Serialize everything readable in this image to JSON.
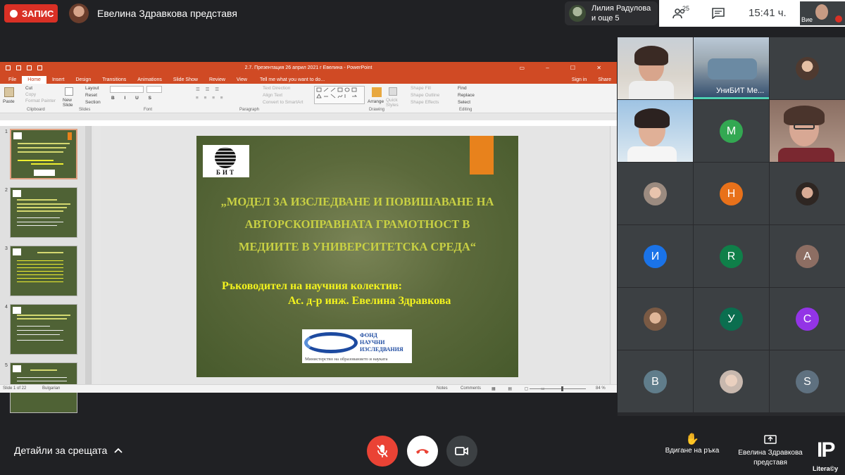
{
  "topbar": {
    "record_label": "ЗАПИС",
    "presenting_text": "Евелина Здравкова представя",
    "chip_line1": "Лилия Радулова",
    "chip_line2": "и още 5",
    "people_count": "25",
    "time": "15:41 ч.",
    "self_label": "Вие"
  },
  "ppt": {
    "window_title": "2.7. Презентация 26 април 2021 г Евелина - PowerPoint",
    "tabs": [
      "File",
      "Home",
      "Insert",
      "Design",
      "Transitions",
      "Animations",
      "Slide Show",
      "Review",
      "View"
    ],
    "tell_me": "Tell me what you want to do...",
    "sign_in": "Sign in",
    "share": "Share",
    "ribbon": {
      "paste": "Paste",
      "cut": "Cut",
      "copy": "Copy",
      "format_painter": "Format Painter",
      "clipboard": "Clipboard",
      "new_slide": "New Slide",
      "layout": "Layout",
      "reset": "Reset",
      "section": "Section",
      "slides": "Slides",
      "font": "Font",
      "paragraph": "Paragraph",
      "text_direction": "Text Direction",
      "align_text": "Align Text",
      "convert_smartart": "Convert to SmartArt",
      "arrange": "Arrange",
      "quick_styles": "Quick Styles",
      "shape_fill": "Shape Fill",
      "shape_outline": "Shape Outline",
      "shape_effects": "Shape Effects",
      "drawing": "Drawing",
      "find": "Find",
      "replace": "Replace",
      "select": "Select",
      "editing": "Editing"
    },
    "slide": {
      "logo_text": "БИТ",
      "title_line1": "„МОДЕЛ ЗА ИЗСЛЕДВАНЕ И ПОВИШАВАНЕ НА",
      "title_line2": "АВТОРСКОПРАВНАТА ГРАМОТНОСТ В",
      "title_line3": "МЕДИИТЕ В УНИВЕРСИТЕТСКА СРЕДА“",
      "leader_label": "Ръководител на научния колектив:",
      "leader_name": "Ас. д-р инж. Евелина Здравкова",
      "fund_line1": "ФОНД",
      "fund_line2": "НАУЧНИ",
      "fund_line3": "ИЗСЛЕДВАНИЯ",
      "ministry": "Министерство на образованието и науката"
    },
    "thumb_numbers": [
      "1",
      "2",
      "3",
      "4",
      "5"
    ],
    "status": {
      "slide_of": "Slide 1 of 22",
      "language": "Bulgarian",
      "notes": "Notes",
      "comments": "Comments",
      "zoom": "84 %"
    }
  },
  "grid": {
    "unibit_label": "УниБИТ Ме...",
    "initials": [
      "M",
      "H",
      "И",
      "R",
      "A",
      "У",
      "C",
      "B",
      "S"
    ],
    "colors": {
      "green": "#33a852",
      "orange": "#e8711a",
      "blue": "#1a73e8",
      "darkgreen": "#0f7f49",
      "brown": "#8d6e63",
      "teal": "#0b6e4f",
      "purple": "#9334e6",
      "slate": "#607d8b",
      "grey": "#5f7180"
    }
  },
  "bottom": {
    "details": "Детайли за срещата",
    "raise_hand": "Вдигане на ръка",
    "presenting_line1": "Евелина Здравкова",
    "presenting_line2": "представя",
    "logo_big": "IP",
    "logo_small": "Litera©y"
  }
}
